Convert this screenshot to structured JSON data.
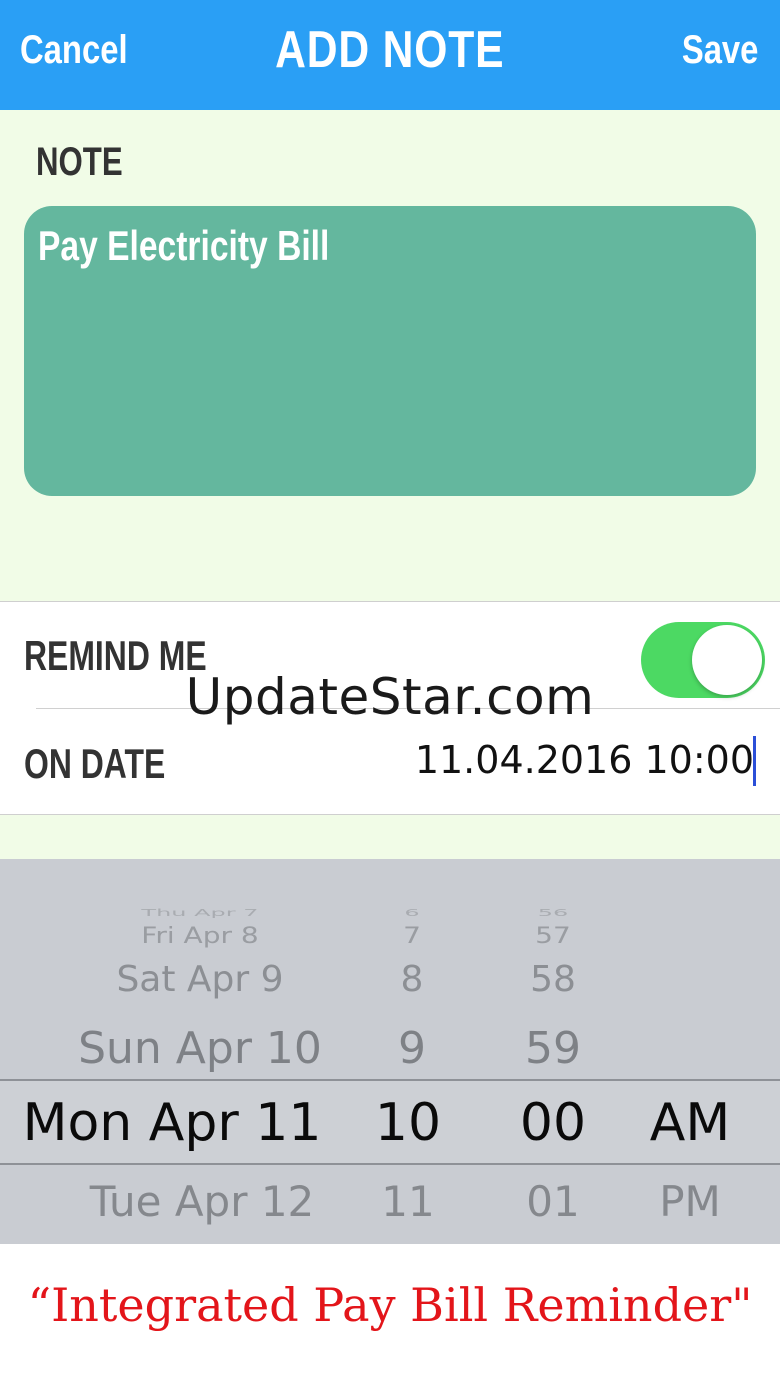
{
  "nav": {
    "cancel_label": "Cancel",
    "title": "ADD NOTE",
    "save_label": "Save",
    "background_color": "#2a9ff5"
  },
  "note": {
    "label": "NOTE",
    "text": "Pay Electricity Bill",
    "box_color": "#64b79e"
  },
  "settings": {
    "remind_me_label": "REMIND ME",
    "remind_me_enabled": true,
    "on_date_label": "ON DATE",
    "on_date_value": "11.04.2016 10:00"
  },
  "watermark": "UpdateStar.com",
  "picker": {
    "dates": [
      "Thu Apr 7",
      "Fri Apr 8",
      "Sat Apr 9",
      "Sun Apr 10",
      "Mon Apr 11",
      "Tue Apr 12"
    ],
    "hours": [
      "6",
      "7",
      "8",
      "9",
      "10",
      "11"
    ],
    "minutes": [
      "56",
      "57",
      "58",
      "59",
      "00",
      "01"
    ],
    "ampm": [
      "AM",
      "PM"
    ],
    "selected": {
      "date": "Mon Apr 11",
      "hour": "10",
      "minute": "00",
      "ampm": "AM"
    }
  },
  "caption": "“Integrated Pay Bill Reminder\""
}
